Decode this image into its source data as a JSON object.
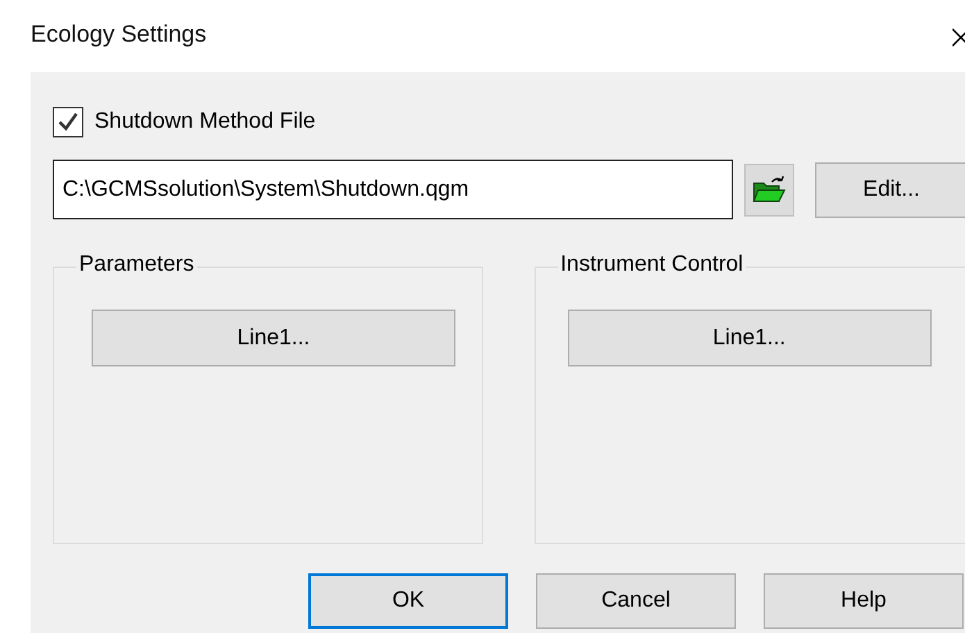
{
  "window": {
    "title": "Ecology Settings"
  },
  "shutdown_file": {
    "label": "Shutdown Method File",
    "checked": true,
    "value": "C:\\GCMSsolution\\System\\Shutdown.qgm",
    "edit_button": "Edit..."
  },
  "groups": [
    {
      "title": "Parameters",
      "button": "Line1..."
    },
    {
      "title": "Instrument Control",
      "button": "Line1..."
    }
  ],
  "buttons": [
    {
      "label": "OK",
      "default": true
    },
    {
      "label": "Cancel",
      "default": false
    },
    {
      "label": "Help",
      "default": false
    }
  ]
}
